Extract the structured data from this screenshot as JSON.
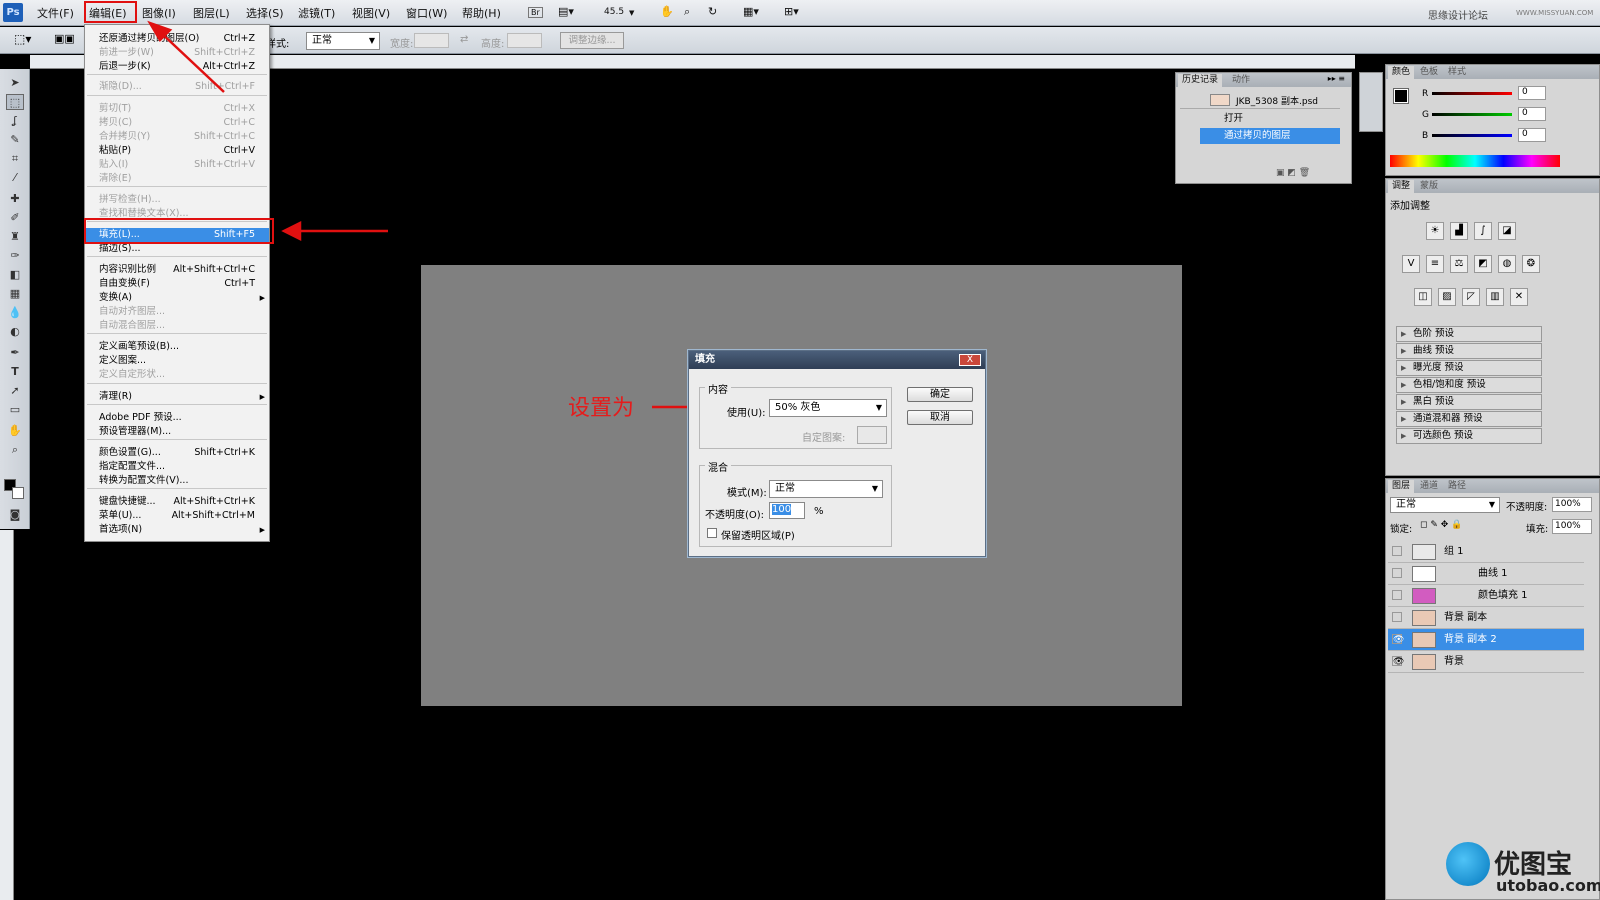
{
  "menubar": {
    "logo": "Ps",
    "items": [
      "文件(F)",
      "编辑(E)",
      "图像(I)",
      "图层(L)",
      "选择(S)",
      "滤镜(T)",
      "视图(V)",
      "窗口(W)",
      "帮助(H)"
    ],
    "zoom": "45.5",
    "watermark_top": "思缘设计论坛",
    "watermark_url": "WWW.MISSYUAN.COM"
  },
  "options": {
    "style_label": "样式:",
    "style_value": "正常",
    "width_label": "宽度:",
    "height_label": "高度:",
    "refine_edge": "调整边缘..."
  },
  "edit_menu": {
    "items": [
      {
        "label": "还原通过拷贝的图层(O)",
        "shortcut": "Ctrl+Z",
        "state": "normal"
      },
      {
        "label": "前进一步(W)",
        "shortcut": "Shift+Ctrl+Z",
        "state": "disabled"
      },
      {
        "label": "后退一步(K)",
        "shortcut": "Alt+Ctrl+Z",
        "state": "normal"
      },
      {
        "label": "渐隐(D)...",
        "shortcut": "Shift+Ctrl+F",
        "state": "disabled"
      },
      {
        "label": "剪切(T)",
        "shortcut": "Ctrl+X",
        "state": "disabled"
      },
      {
        "label": "拷贝(C)",
        "shortcut": "Ctrl+C",
        "state": "disabled"
      },
      {
        "label": "合并拷贝(Y)",
        "shortcut": "Shift+Ctrl+C",
        "state": "disabled"
      },
      {
        "label": "粘贴(P)",
        "shortcut": "Ctrl+V",
        "state": "normal"
      },
      {
        "label": "贴入(I)",
        "shortcut": "Shift+Ctrl+V",
        "state": "disabled"
      },
      {
        "label": "清除(E)",
        "shortcut": "",
        "state": "disabled"
      },
      {
        "label": "拼写检查(H)...",
        "shortcut": "",
        "state": "disabled"
      },
      {
        "label": "查找和替换文本(X)...",
        "shortcut": "",
        "state": "disabled"
      },
      {
        "label": "填充(L)...",
        "shortcut": "Shift+F5",
        "state": "highlight"
      },
      {
        "label": "描边(S)...",
        "shortcut": "",
        "state": "normal"
      },
      {
        "label": "内容识别比例",
        "shortcut": "Alt+Shift+Ctrl+C",
        "state": "normal"
      },
      {
        "label": "自由变换(F)",
        "shortcut": "Ctrl+T",
        "state": "normal"
      },
      {
        "label": "变换(A)",
        "shortcut": "",
        "state": "submenu"
      },
      {
        "label": "自动对齐图层...",
        "shortcut": "",
        "state": "disabled"
      },
      {
        "label": "自动混合图层...",
        "shortcut": "",
        "state": "disabled"
      },
      {
        "label": "定义画笔预设(B)...",
        "shortcut": "",
        "state": "normal"
      },
      {
        "label": "定义图案...",
        "shortcut": "",
        "state": "normal"
      },
      {
        "label": "定义自定形状...",
        "shortcut": "",
        "state": "disabled"
      },
      {
        "label": "清理(R)",
        "shortcut": "",
        "state": "submenu"
      },
      {
        "label": "Adobe PDF 预设...",
        "shortcut": "",
        "state": "normal"
      },
      {
        "label": "预设管理器(M)...",
        "shortcut": "",
        "state": "normal"
      },
      {
        "label": "颜色设置(G)...",
        "shortcut": "Shift+Ctrl+K",
        "state": "normal"
      },
      {
        "label": "指定配置文件...",
        "shortcut": "",
        "state": "normal"
      },
      {
        "label": "转换为配置文件(V)...",
        "shortcut": "",
        "state": "normal"
      },
      {
        "label": "键盘快捷键...",
        "shortcut": "Alt+Shift+Ctrl+K",
        "state": "normal"
      },
      {
        "label": "菜单(U)...",
        "shortcut": "Alt+Shift+Ctrl+M",
        "state": "normal"
      },
      {
        "label": "首选项(N)",
        "shortcut": "",
        "state": "submenu"
      }
    ]
  },
  "annotation": {
    "text": "设置为"
  },
  "fill_dialog": {
    "title": "填充",
    "close": "X",
    "content_group": "内容",
    "use_label": "使用(U):",
    "use_value": "50% 灰色",
    "custom_pattern_label": "自定图案:",
    "blend_group": "混合",
    "mode_label": "模式(M):",
    "mode_value": "正常",
    "opacity_label": "不透明度(O):",
    "opacity_value": "100",
    "opacity_unit": "%",
    "preserve_label": "保留透明区域(P)",
    "ok": "确定",
    "cancel": "取消"
  },
  "history_panel": {
    "tabs": [
      "历史记录",
      "动作"
    ],
    "snapshot": "JKB_5308 副本.psd",
    "steps": [
      "打开",
      "通过拷贝的图层"
    ]
  },
  "color_panel": {
    "tabs": [
      "颜色",
      "色板",
      "样式"
    ],
    "r_label": "R",
    "r_value": "0",
    "g_label": "G",
    "g_value": "0",
    "b_label": "B",
    "b_value": "0"
  },
  "adjust_panel": {
    "tabs": [
      "调整",
      "蒙版"
    ],
    "title": "添加调整",
    "presets": [
      "色阶 预设",
      "曲线 预设",
      "曝光度 预设",
      "色相/饱和度 预设",
      "黑白 预设",
      "通道混和器 预设",
      "可选颜色 预设"
    ]
  },
  "layers_panel": {
    "tabs": [
      "图层",
      "通道",
      "路径"
    ],
    "blend_mode": "正常",
    "opacity_label": "不透明度:",
    "opacity_value": "100%",
    "lock_label": "锁定:",
    "fill_label": "填充:",
    "fill_value": "100%",
    "layers": [
      {
        "name": "组 1",
        "visible": false,
        "selected": false
      },
      {
        "name": "曲线 1",
        "visible": false,
        "selected": false
      },
      {
        "name": "颜色填充 1",
        "visible": false,
        "selected": false
      },
      {
        "name": "背景 副本",
        "visible": false,
        "selected": false
      },
      {
        "name": "背景 副本 2",
        "visible": true,
        "selected": true
      },
      {
        "name": "背景",
        "visible": true,
        "selected": false
      }
    ]
  },
  "brand": {
    "name": "优图宝",
    "url": "utobao.com"
  }
}
